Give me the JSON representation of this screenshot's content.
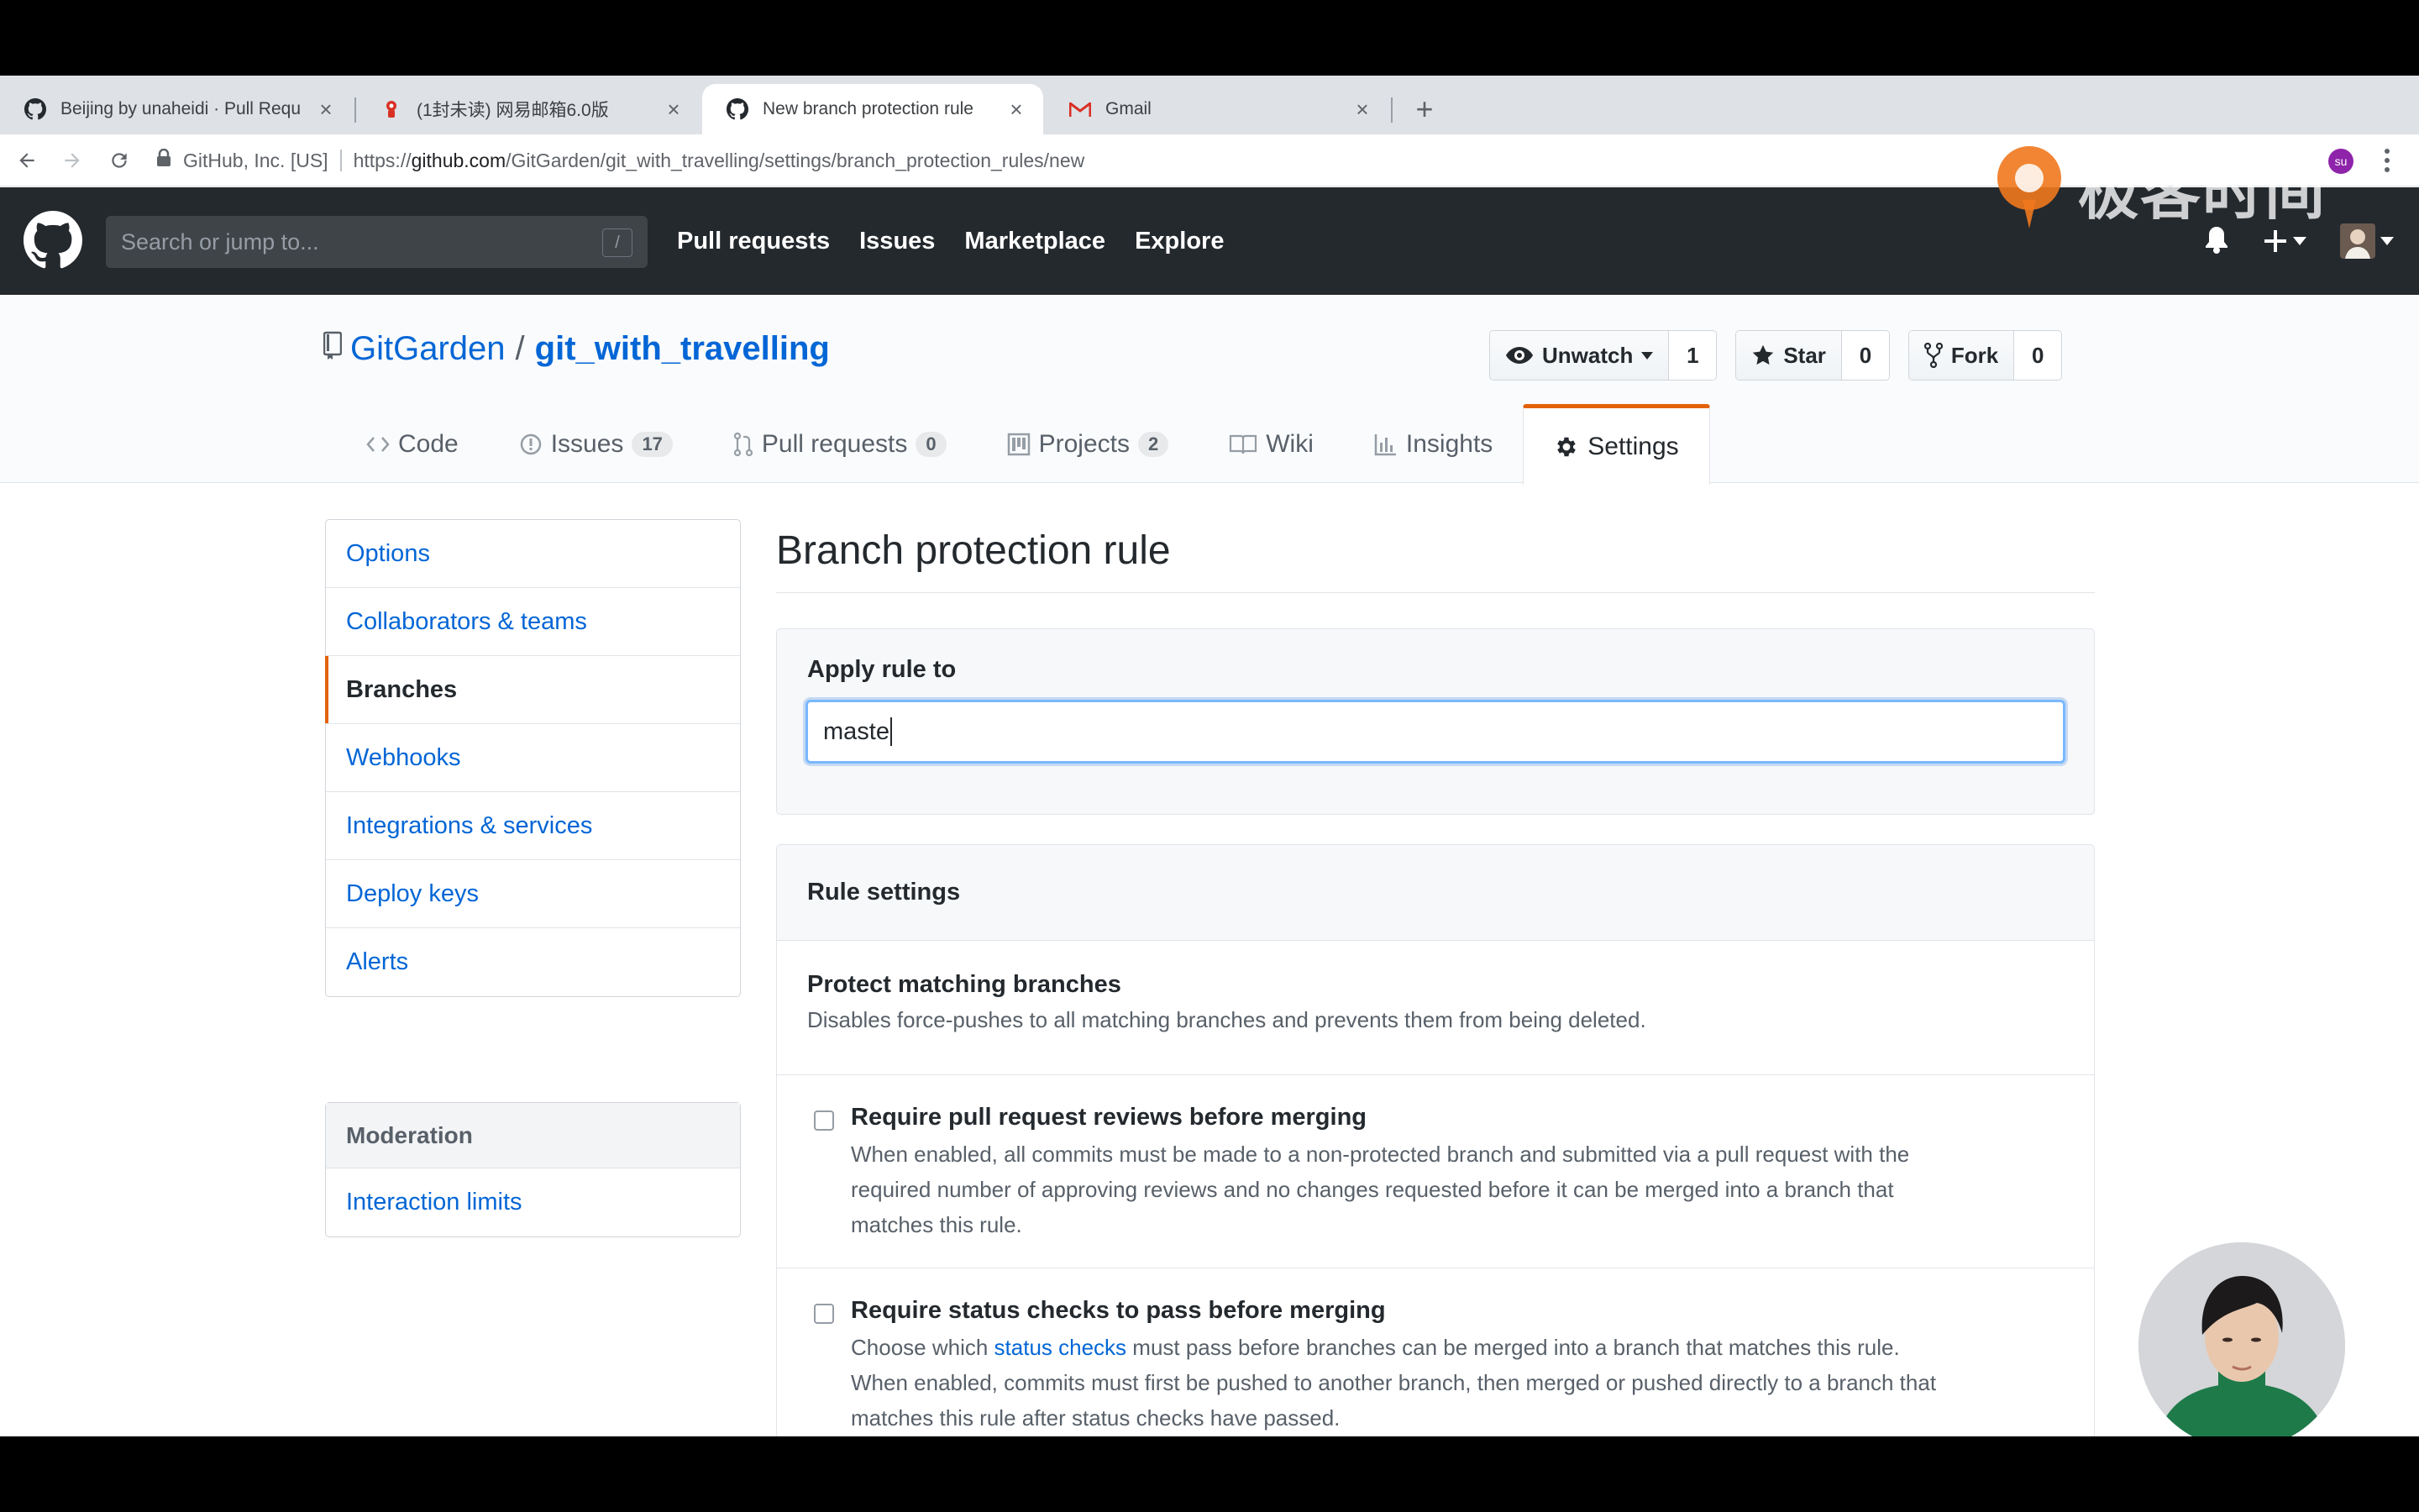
{
  "browser": {
    "tabs": [
      {
        "title": "Beijing by unaheidi · Pull Requ",
        "icon": "github-icon"
      },
      {
        "title": "(1封未读) 网易邮箱6.0版",
        "icon": "netease-mail-icon"
      },
      {
        "title": "New branch protection rule",
        "icon": "github-icon"
      },
      {
        "title": "Gmail",
        "icon": "gmail-icon"
      }
    ],
    "close_glyph": "×",
    "new_tab_glyph": "+",
    "address": {
      "org": "GitHub, Inc. [US]",
      "url_prefix": "https://",
      "url_host": "github.com",
      "url_path": "/GitGarden/git_with_travelling/settings/branch_protection_rules/new"
    },
    "profile_badge": "su"
  },
  "watermark": {
    "text": "极客时间"
  },
  "github_header": {
    "search_placeholder": "Search or jump to...",
    "search_shortcut": "/",
    "nav": [
      "Pull requests",
      "Issues",
      "Marketplace",
      "Explore"
    ]
  },
  "repo": {
    "owner": "GitGarden",
    "separator": "/",
    "name": "git_with_travelling",
    "actions": {
      "watch_label": "Unwatch",
      "watch_count": "1",
      "star_label": "Star",
      "star_count": "0",
      "fork_label": "Fork",
      "fork_count": "0"
    },
    "tabs": [
      {
        "label": "Code",
        "count": ""
      },
      {
        "label": "Issues",
        "count": "17"
      },
      {
        "label": "Pull requests",
        "count": "0"
      },
      {
        "label": "Projects",
        "count": "2"
      },
      {
        "label": "Wiki",
        "count": ""
      },
      {
        "label": "Insights",
        "count": ""
      },
      {
        "label": "Settings",
        "count": ""
      }
    ]
  },
  "sidebar": {
    "items": [
      "Options",
      "Collaborators & teams",
      "Branches",
      "Webhooks",
      "Integrations & services",
      "Deploy keys",
      "Alerts"
    ],
    "selected": "Branches",
    "moderation_heading": "Moderation",
    "moderation_items": [
      "Interaction limits"
    ]
  },
  "main": {
    "title": "Branch protection rule",
    "apply_label": "Apply rule to",
    "apply_value": "maste",
    "rule_settings_heading": "Rule settings",
    "protect_title": "Protect matching branches",
    "protect_desc": "Disables force-pushes to all matching branches and prevents them from being deleted.",
    "options": [
      {
        "title": "Require pull request reviews before merging",
        "checked": false,
        "desc_lines": [
          "When enabled, all commits must be made to a non-protected branch and submitted via a pull request with the",
          "required number of approving reviews and no changes requested before it can be merged into a branch that",
          "matches this rule."
        ]
      },
      {
        "title": "Require status checks to pass before merging",
        "checked": false,
        "desc_line1_pre": "Choose which ",
        "desc_line1_link": "status checks",
        "desc_line1_post": " must pass before branches can be merged into a branch that matches this rule.",
        "desc_lines": [
          "When enabled, commits must first be pushed to another branch, then merged or pushed directly to a branch that",
          "matches this rule after status checks have passed."
        ]
      }
    ]
  },
  "colors": {
    "link": "#0366d6",
    "header_bg": "#24292e",
    "accent_orange": "#e36209",
    "focus_ring": "#79b8ff"
  }
}
